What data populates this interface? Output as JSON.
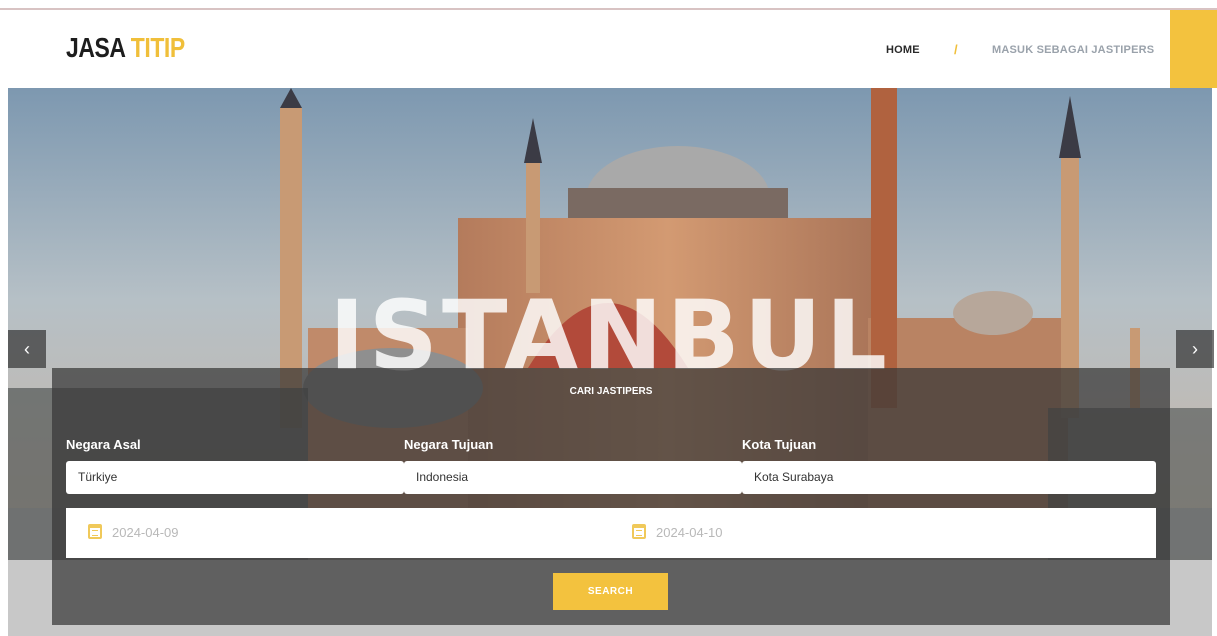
{
  "brand": {
    "part1": "JASA",
    "part2": "TITIP"
  },
  "nav": {
    "home": "HOME",
    "separator": "/",
    "login": "MASUK SEBAGAI JASTIPERS"
  },
  "hero": {
    "title": "ISTANBUL",
    "prev_icon": "‹",
    "next_icon": "›"
  },
  "search": {
    "title": "CARI JASTIPERS",
    "origin_label": "Negara Asal",
    "origin_value": "Türkiye",
    "dest_country_label": "Negara Tujuan",
    "dest_country_value": "Indonesia",
    "dest_city_label": "Kota Tujuan",
    "dest_city_value": "Kota Surabaya",
    "date_from": "2024-04-09",
    "date_to": "2024-04-10",
    "button": "SEARCH"
  },
  "colors": {
    "accent": "#f3c23e",
    "dark": "#1d1d1d",
    "muted_nav": "#9aa2ab"
  },
  "icons": [
    "chevron-left-icon",
    "chevron-right-icon",
    "calendar-icon"
  ]
}
